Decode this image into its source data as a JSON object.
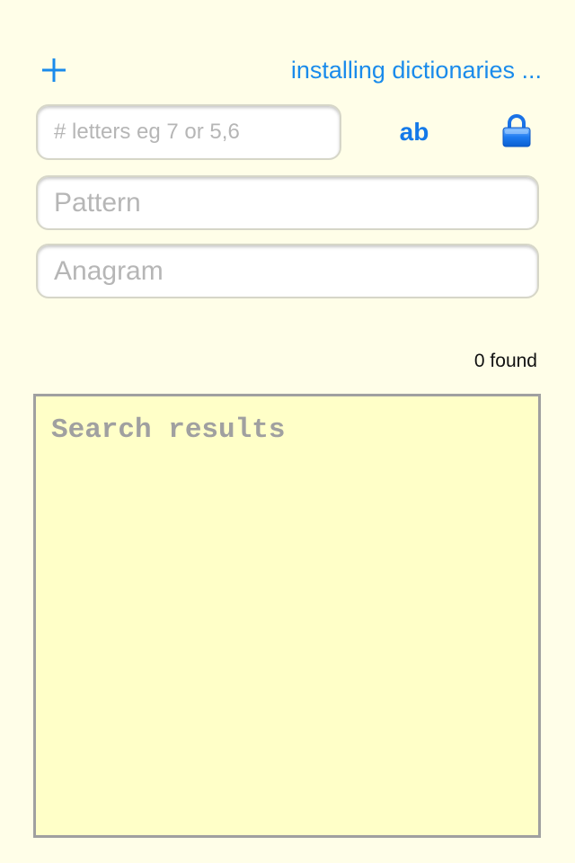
{
  "toolbar": {
    "add_icon": "plus-icon",
    "status_text": "installing dictionaries ...",
    "accent_color": "#1A8BEB"
  },
  "search": {
    "letters_placeholder": "# letters eg 7 or 5,6",
    "letters_value": "",
    "case_toggle_label": "ab",
    "lock_icon": "lock-icon",
    "pattern_placeholder": "Pattern",
    "pattern_value": "",
    "anagram_placeholder": "Anagram",
    "anagram_value": ""
  },
  "results": {
    "found_text": "0 found",
    "placeholder": "Search results",
    "value": ""
  },
  "colors": {
    "background": "#FFFEE8",
    "results_background": "#FFFFC8",
    "link_blue": "#1479E8"
  }
}
